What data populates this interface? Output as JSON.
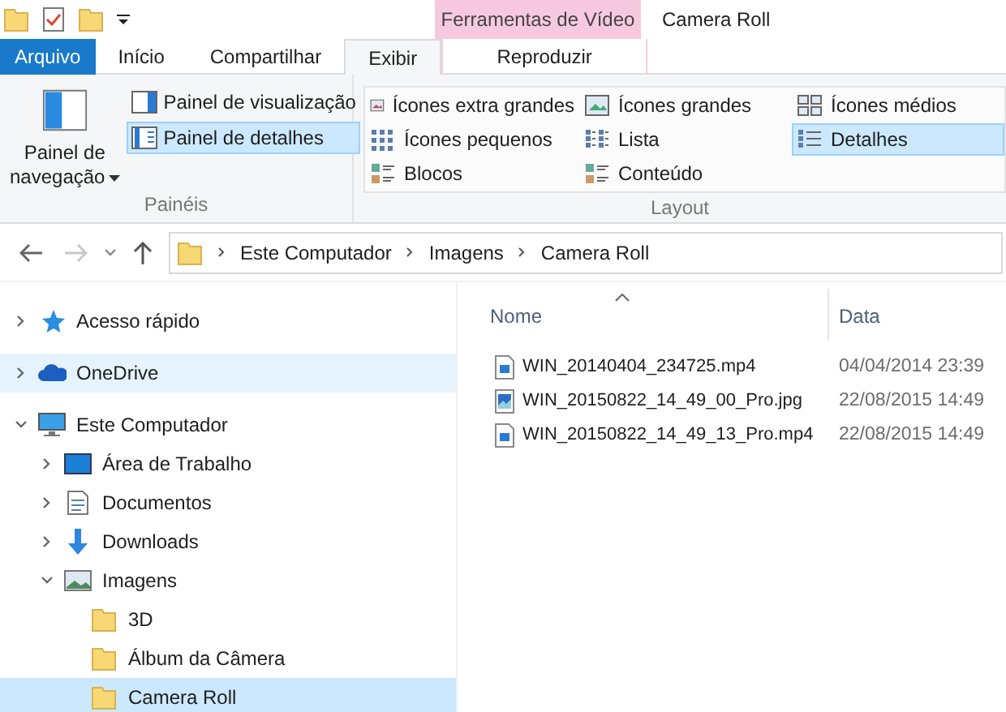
{
  "quick_access": [
    {
      "kind": "folder"
    },
    {
      "kind": "properties"
    },
    {
      "kind": "new-folder"
    },
    {
      "kind": "customize"
    }
  ],
  "contextual_group": {
    "label": "Ferramentas de Vídeo"
  },
  "window": {
    "title": "Camera Roll"
  },
  "tabs": [
    {
      "label": "Arquivo",
      "kind": "file",
      "selected": false
    },
    {
      "label": "Início",
      "kind": "tab",
      "selected": false
    },
    {
      "label": "Compartilhar",
      "kind": "tab",
      "selected": false
    },
    {
      "label": "Exibir",
      "kind": "tab",
      "selected": true
    },
    {
      "label": "Reproduzir",
      "kind": "contextual",
      "selected": false
    }
  ],
  "ribbon": {
    "panes": {
      "label": "Painéis",
      "navigation_pane": {
        "label_lines": [
          "Painel de",
          "navegação"
        ]
      },
      "items": [
        {
          "label": "Painel de visualização",
          "selected": false
        },
        {
          "label": "Painel de detalhes",
          "selected": true
        }
      ]
    },
    "layout": {
      "label": "Layout",
      "options": [
        {
          "label": "Ícones extra grandes",
          "kind": "xl",
          "selected": false
        },
        {
          "label": "Ícones grandes",
          "kind": "large",
          "selected": false
        },
        {
          "label": "Ícones médios",
          "kind": "medium",
          "selected": false
        },
        {
          "label": "Ícones pequenos",
          "kind": "small",
          "selected": false
        },
        {
          "label": "Lista",
          "kind": "list",
          "selected": false
        },
        {
          "label": "Detalhes",
          "kind": "details",
          "selected": true
        },
        {
          "label": "Blocos",
          "kind": "tiles",
          "selected": false
        },
        {
          "label": "Conteúdo",
          "kind": "content",
          "selected": false
        }
      ]
    }
  },
  "address_bar": {
    "back_disabled": false,
    "forward_disabled": true,
    "path": [
      "Este Computador",
      "Imagens",
      "Camera Roll"
    ]
  },
  "sidebar": {
    "groups": [
      [
        {
          "label": "Acesso rápido",
          "kind": "star",
          "expanded": false,
          "selected": false,
          "hovered": false
        }
      ],
      [
        {
          "label": "OneDrive",
          "kind": "cloud",
          "expanded": false,
          "selected": false,
          "hovered": true
        }
      ],
      [
        {
          "label": "Este Computador",
          "kind": "computer",
          "expanded": true,
          "selected": false,
          "hovered": false,
          "children": [
            {
              "label": "Área de Trabalho",
              "kind": "desktop",
              "expanded": false,
              "selected": false,
              "hovered": false
            },
            {
              "label": "Documentos",
              "kind": "documents",
              "expanded": false,
              "selected": false,
              "hovered": false
            },
            {
              "label": "Downloads",
              "kind": "downloads",
              "expanded": false,
              "selected": false,
              "hovered": false
            },
            {
              "label": "Imagens",
              "kind": "pictures",
              "expanded": true,
              "selected": false,
              "hovered": false,
              "children": [
                {
                  "label": "3D",
                  "kind": "folder",
                  "selected": false,
                  "hovered": false
                },
                {
                  "label": "Álbum da Câmera",
                  "kind": "folder",
                  "selected": false,
                  "hovered": false
                },
                {
                  "label": "Camera Roll",
                  "kind": "folder",
                  "selected": true,
                  "hovered": false
                }
              ]
            }
          ]
        }
      ]
    ]
  },
  "file_list": {
    "columns": [
      {
        "label": "Nome",
        "sorted": true
      },
      {
        "label": "Data",
        "sorted": false
      }
    ],
    "rows": [
      {
        "name": "WIN_20140404_234725.mp4",
        "kind": "video",
        "date": "04/04/2014 23:39"
      },
      {
        "name": "WIN_20150822_14_49_00_Pro.jpg",
        "kind": "image",
        "date": "22/08/2015 14:49"
      },
      {
        "name": "WIN_20150822_14_49_13_Pro.mp4",
        "kind": "video",
        "date": "22/08/2015 14:49"
      }
    ]
  }
}
